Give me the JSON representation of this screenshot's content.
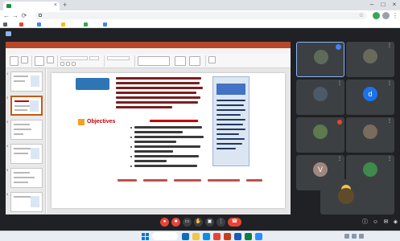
{
  "browser": {
    "tab_title": "",
    "url": "",
    "bookmarks": [
      "",
      "",
      "",
      "",
      "",
      ""
    ]
  },
  "call": {
    "presenting_label": "",
    "meeting_time": "",
    "self_name": "",
    "participants": [
      {
        "name": "",
        "initial": "",
        "color": "#5f6b5a"
      },
      {
        "name": "",
        "initial": "",
        "color": "#6a6a5c"
      },
      {
        "name": "",
        "initial": "",
        "color": "#4b5a6a"
      },
      {
        "name": "",
        "initial": "d",
        "color": "#1a73e8"
      },
      {
        "name": "",
        "initial": "",
        "color": "#5c7a4b"
      },
      {
        "name": "",
        "initial": "",
        "color": "#7a6b5c"
      },
      {
        "name": "",
        "initial": "V",
        "color": "#a1887f"
      },
      {
        "name": "",
        "initial": "",
        "color": "#3f8a4b"
      }
    ]
  },
  "powerpoint": {
    "window_title": "",
    "menu_items": [
      "",
      "",
      "",
      "",
      "",
      "",
      "",
      "",
      "",
      "",
      ""
    ],
    "active_menu_index": 0,
    "slide": {
      "blue_box_text": "",
      "objectives_heading": "Objectives",
      "panel_title": "",
      "footer_label": "",
      "footer_sublabel": ""
    }
  },
  "taskbar": {
    "search_label": "",
    "clock_time": "",
    "clock_date": ""
  },
  "colors": {
    "ppt_accent": "#b7472a",
    "meet_bg": "#202124",
    "end_call": "#ea4335",
    "slide_blue": "#2e75b6"
  }
}
